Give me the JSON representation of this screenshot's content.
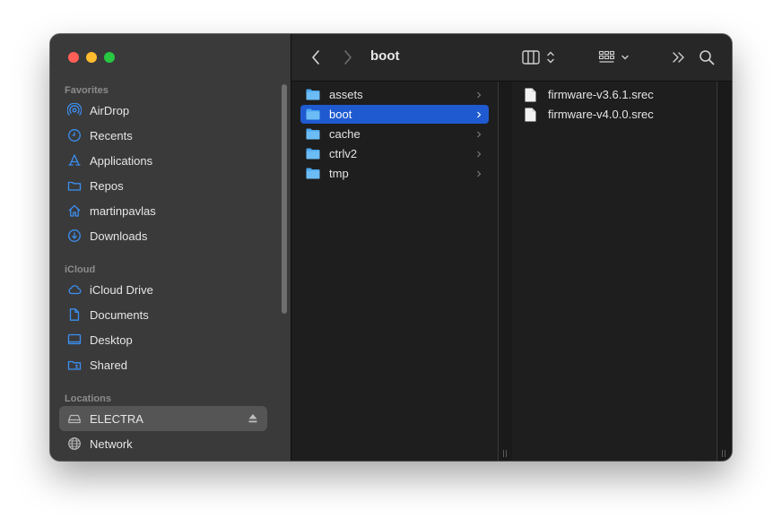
{
  "window": {
    "traffic_lights": [
      "close",
      "minimize",
      "zoom"
    ]
  },
  "sidebar": {
    "sections": [
      {
        "title": "Favorites",
        "items": [
          {
            "label": "AirDrop",
            "icon": "airdrop-icon"
          },
          {
            "label": "Recents",
            "icon": "clock-icon"
          },
          {
            "label": "Applications",
            "icon": "applications-icon"
          },
          {
            "label": "Repos",
            "icon": "folder-icon"
          },
          {
            "label": "martinpavlas",
            "icon": "home-icon"
          },
          {
            "label": "Downloads",
            "icon": "download-icon"
          }
        ]
      },
      {
        "title": "iCloud",
        "items": [
          {
            "label": "iCloud Drive",
            "icon": "cloud-icon"
          },
          {
            "label": "Documents",
            "icon": "document-icon"
          },
          {
            "label": "Desktop",
            "icon": "desktop-icon"
          },
          {
            "label": "Shared",
            "icon": "shared-folder-icon"
          }
        ]
      },
      {
        "title": "Locations",
        "items": [
          {
            "label": "ELECTRA",
            "icon": "drive-icon",
            "selected": true,
            "ejectable": true
          },
          {
            "label": "Network",
            "icon": "network-icon"
          }
        ]
      }
    ]
  },
  "toolbar": {
    "title": "boot",
    "back_icon": "chevron-left-icon",
    "forward_icon": "chevron-right-icon",
    "view_icon": "column-view-icon",
    "group_icon": "grid-group-icon",
    "more_icon": "double-chevron-icon",
    "search_icon": "search-icon"
  },
  "columns": {
    "folders": [
      {
        "label": "assets"
      },
      {
        "label": "boot",
        "selected": true
      },
      {
        "label": "cache"
      },
      {
        "label": "ctrlv2"
      },
      {
        "label": "tmp"
      }
    ],
    "files": [
      {
        "label": "firmware-v3.6.1.srec"
      },
      {
        "label": "firmware-v4.0.0.srec"
      }
    ]
  },
  "colors": {
    "selection": "#1f5ad0",
    "folder": "#4aa8ef",
    "sidebar_icon": "#3b8ff0"
  }
}
